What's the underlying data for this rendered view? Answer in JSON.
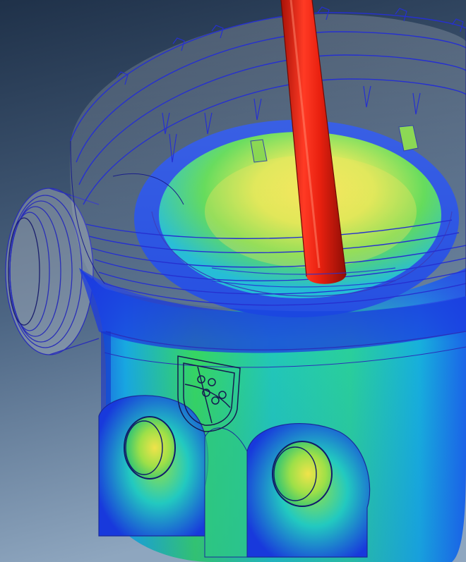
{
  "scene": {
    "subject": "",
    "colors": {
      "background_top": "#23364f",
      "background_bottom": "#7c97b3",
      "wireframe": "#2b2fd6",
      "probe": "#e01f12",
      "low": "#1430d8",
      "mid_low": "#14b4d8",
      "mid": "#3fd84e",
      "mid_high": "#c8e34a",
      "high": "#f2e04a"
    },
    "icons": [
      "coat-of-arms-emblem"
    ]
  }
}
